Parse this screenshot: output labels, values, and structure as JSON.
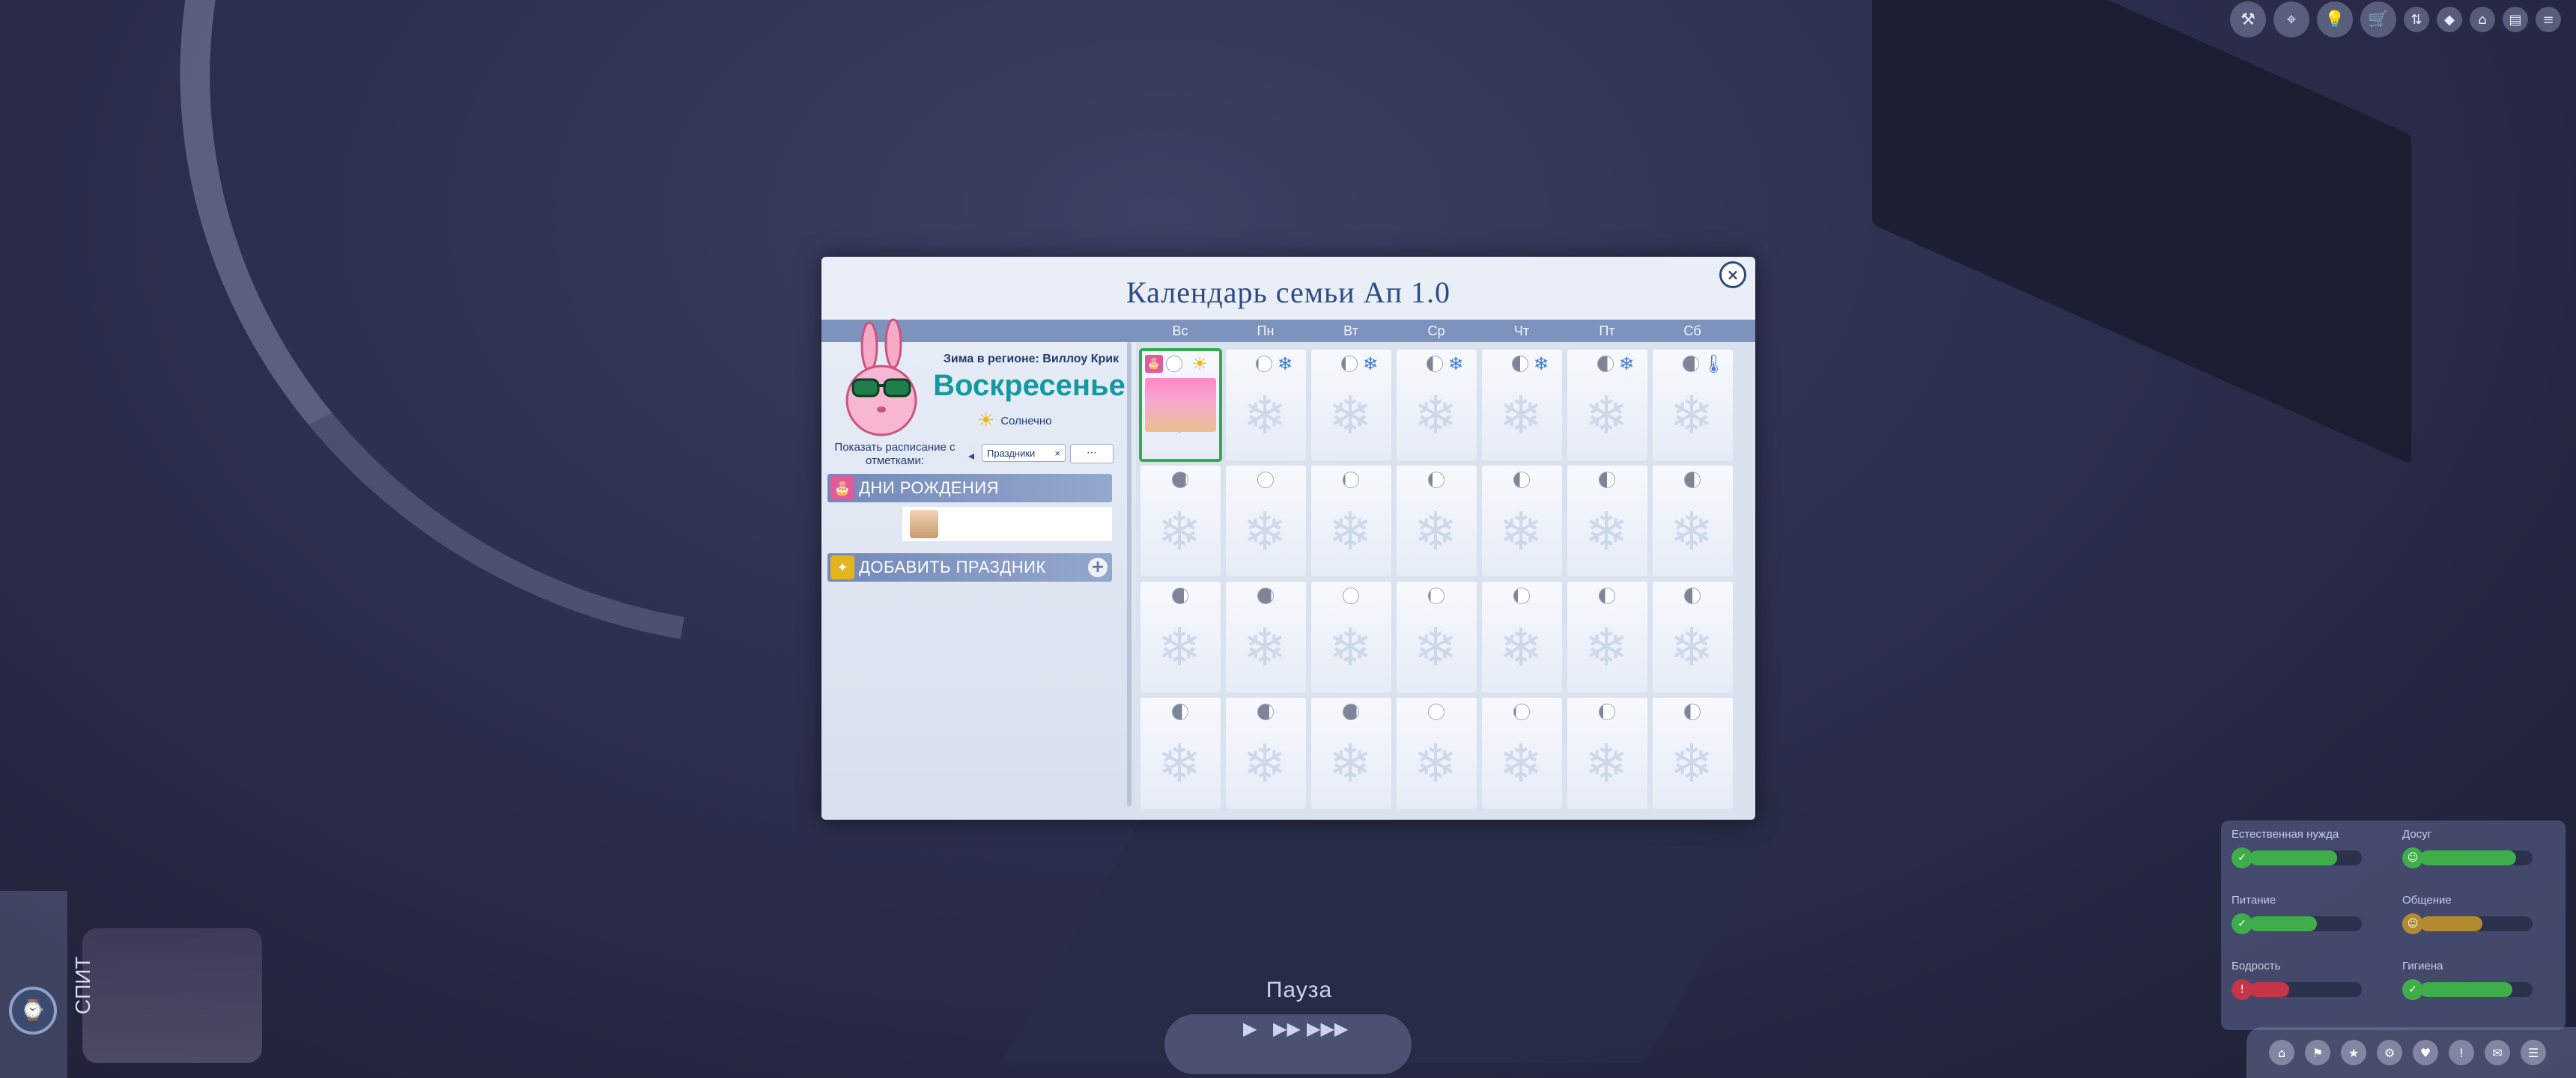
{
  "dialog": {
    "title": "Календарь семьи Ап 1.0",
    "close_label": "×"
  },
  "days_header": [
    "Вс",
    "Пн",
    "Вт",
    "Ср",
    "Чт",
    "Пт",
    "Сб"
  ],
  "left_panel": {
    "region_label": "Зима в регионе: Виллоу Крик",
    "day_name": "Воскресенье",
    "weather": "Солнечно",
    "schedule_label": "Показать расписание с отметками:",
    "filter_value": "Праздники",
    "filter_clear": "×",
    "filter_more": "⋯",
    "sections": {
      "birthdays_title": "ДНИ РОЖДЕНИЯ",
      "add_holiday_title": "ДОБАВИТЬ ПРАЗДНИК",
      "add_plus": "+"
    }
  },
  "week_weather": [
    "☀",
    "❄",
    "❄",
    "❄",
    "❄",
    "❄",
    "🌡"
  ],
  "hud": {
    "pause_label": "Пауза",
    "sleep_label": "СПИТ",
    "speed_play": "▶",
    "speed_fast": "▶▶",
    "speed_ultra": "▶▶▶",
    "needs": [
      {
        "label": "Естественная нужда",
        "level": 0.78,
        "color": "#3fae4a",
        "icon": "✓"
      },
      {
        "label": "Досуг",
        "level": 0.85,
        "color": "#3fae4a",
        "icon": "☺"
      },
      {
        "label": "Питание",
        "level": 0.6,
        "color": "#3fae4a",
        "icon": "✓"
      },
      {
        "label": "Общение",
        "level": 0.55,
        "color": "#b38a2f",
        "icon": "☺"
      },
      {
        "label": "Бодрость",
        "level": 0.35,
        "color": "#c33547",
        "icon": "!"
      },
      {
        "label": "Гигиена",
        "level": 0.82,
        "color": "#3fae4a",
        "icon": "✓"
      }
    ]
  }
}
